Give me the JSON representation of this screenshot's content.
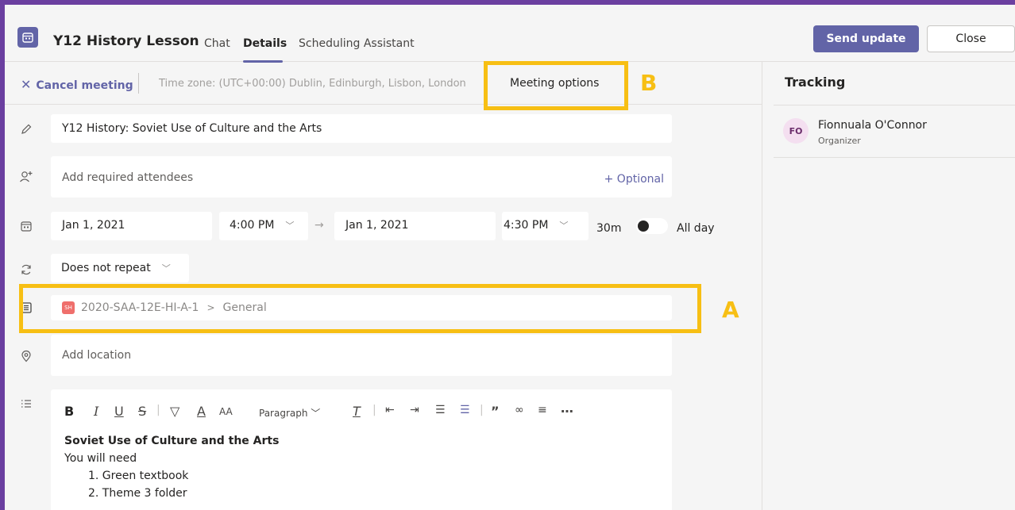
{
  "header": {
    "title": "Y12 History Lesson",
    "tabs": [
      {
        "label": "Chat"
      },
      {
        "label": "Details"
      },
      {
        "label": "Scheduling Assistant"
      }
    ],
    "send_update_label": "Send update",
    "close_label": "Close"
  },
  "toolbar": {
    "cancel_label": "Cancel meeting",
    "timezone": "Time zone: (UTC+00:00) Dublin, Edinburgh, Lisbon, London",
    "meeting_options_label": "Meeting options"
  },
  "form": {
    "title_value": "Y12 History: Soviet Use of Culture and the Arts",
    "attendees_placeholder": "Add required attendees",
    "optional_label": "+ Optional",
    "start_date": "Jan 1, 2021",
    "start_time": "4:00 PM",
    "end_date": "Jan 1, 2021",
    "end_time": "4:30 PM",
    "duration": "30m",
    "all_day_label": "All day",
    "all_day_on": false,
    "repeat_value": "Does not repeat",
    "channel_badge": "SH",
    "channel_team": "2020-SAA-12E-HI-A-1",
    "channel_name": "General",
    "location_placeholder": "Add location"
  },
  "editor": {
    "paragraph_label": "Paragraph",
    "heading": "Soviet Use of Culture and the Arts",
    "line1": "You will need",
    "items": [
      "1. Green textbook",
      "2. Theme 3 folder"
    ]
  },
  "tracking": {
    "title": "Tracking",
    "people": [
      {
        "initials": "FO",
        "name": "Fionnuala O'Connor",
        "role": "Organizer"
      }
    ]
  },
  "annotations": {
    "a_label": "A",
    "b_label": "B"
  },
  "colors": {
    "accent": "#6264a7",
    "frame": "#6b3fa0",
    "highlight": "#f7bf14"
  }
}
